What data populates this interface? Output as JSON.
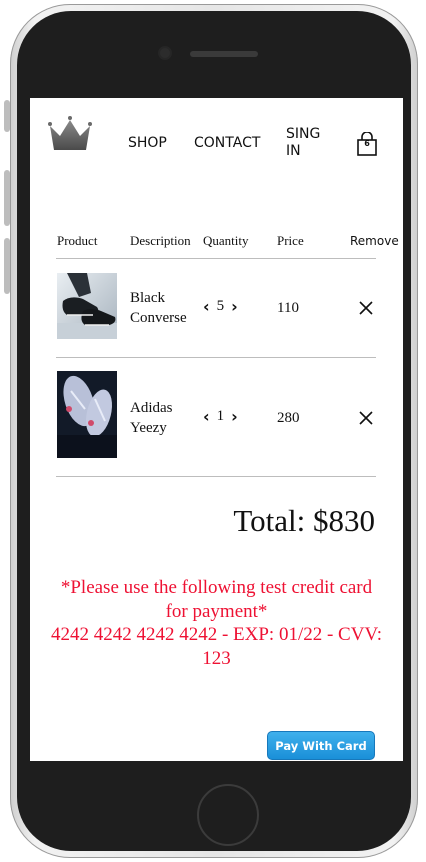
{
  "nav": {
    "items": [
      {
        "label": "SHOP"
      },
      {
        "label": "CONTACT"
      },
      {
        "label": "SING IN"
      }
    ],
    "cart_count": "6"
  },
  "table": {
    "headers": [
      "Product",
      "Description",
      "Quantity",
      "Price",
      "Remove"
    ],
    "rows": [
      {
        "description": "Black Converse",
        "quantity": "5",
        "price": "110"
      },
      {
        "description": "Adidas Yeezy",
        "quantity": "1",
        "price": "280"
      }
    ]
  },
  "total": "Total: $830",
  "notice": {
    "line1": "*Please use the following test credit card for payment*",
    "line2": "4242 4242 4242 4242 - EXP: 01/22 - CVV: 123"
  },
  "pay_button": "Pay With Card",
  "colors": {
    "notice": "#ee1133",
    "pay_button": "#1f96de"
  }
}
